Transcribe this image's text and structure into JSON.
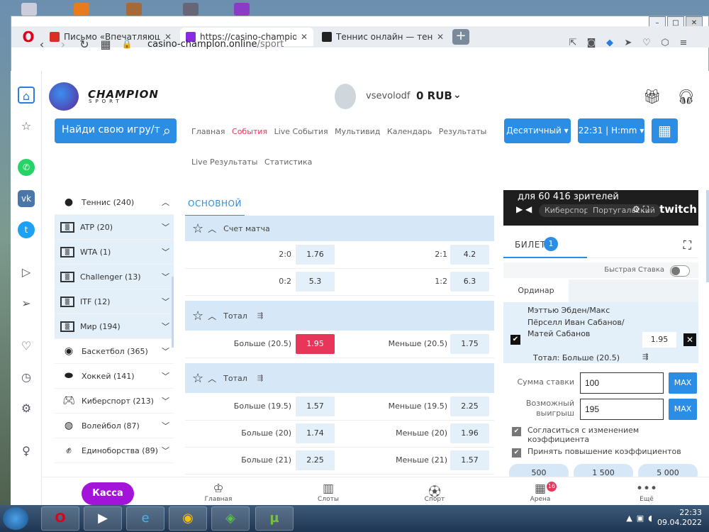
{
  "browser": {
    "tabs": [
      {
        "label": "Письмо «Впечатляющий ж",
        "icon": "gmail-icon",
        "color": "#d93025"
      },
      {
        "label": "https://casino-champion.o",
        "icon": "casino-icon",
        "color": "#8a2be2"
      },
      {
        "label": "Теннис онлайн — теннис",
        "icon": "tennis-site-icon",
        "color": "#222222"
      }
    ],
    "url_host": "casino-champion.online",
    "url_path": "/sport"
  },
  "site": {
    "logo": "CHAMPION",
    "logo_sub": "SPORT",
    "username": "vsevolodf",
    "balance": "0 RUB",
    "search_label": "Найди свою игру/т",
    "nav": [
      "Главная",
      "События",
      "Live События",
      "Мультивид",
      "Календарь",
      "Результаты",
      "Live Результаты",
      "Статистика"
    ],
    "active_nav": "События",
    "odds_format": "Десятичный",
    "time_format": "22:31 | H:mm"
  },
  "sports": [
    {
      "label": "Теннис (240)",
      "sub": false,
      "icon": "tennis-icon"
    },
    {
      "label": "ATP (20)",
      "sub": true,
      "icon": "world-map-icon"
    },
    {
      "label": "WTA (1)",
      "sub": true,
      "icon": "world-map-icon"
    },
    {
      "label": "Challenger (13)",
      "sub": true,
      "icon": "world-map-icon"
    },
    {
      "label": "ITF (12)",
      "sub": true,
      "icon": "world-map-icon"
    },
    {
      "label": "Мир (194)",
      "sub": true,
      "icon": "world-map-icon"
    },
    {
      "label": "Баскетбол (365)",
      "sub": false,
      "icon": "basketball-icon"
    },
    {
      "label": "Хоккей (141)",
      "sub": false,
      "icon": "hockey-icon"
    },
    {
      "label": "Киберспорт (213)",
      "sub": false,
      "icon": "gamepad-icon"
    },
    {
      "label": "Волейбол (87)",
      "sub": false,
      "icon": "volleyball-icon"
    },
    {
      "label": "Единоборства (89)",
      "sub": false,
      "icon": "fight-icon"
    }
  ],
  "center": {
    "tab": "ОСНОВНОЙ",
    "markets": [
      {
        "title": "Счет матча",
        "rows": [
          {
            "l": "2:0",
            "lo": "1.76",
            "r": "2:1",
            "ro": "4.2"
          },
          {
            "l": "0:2",
            "lo": "5.3",
            "r": "1:2",
            "ro": "6.3"
          }
        ]
      },
      {
        "title": "Тотал",
        "rows": [
          {
            "l": "Больше (20.5)",
            "lo": "1.95",
            "r": "Меньше (20.5)",
            "ro": "1.75",
            "selected": true
          }
        ]
      },
      {
        "title": "Тотал",
        "rows": [
          {
            "l": "Больше (19.5)",
            "lo": "1.57",
            "r": "Меньше (19.5)",
            "ro": "2.25"
          },
          {
            "l": "Больше (20)",
            "lo": "1.74",
            "r": "Меньше (20)",
            "ro": "1.96"
          },
          {
            "l": "Больше (21)",
            "lo": "2.25",
            "r": "Меньше (21)",
            "ro": "1.57"
          }
        ]
      }
    ]
  },
  "stream": {
    "title": "для 60 416 зрителей",
    "tag1": "Киберспорт",
    "tag2": "Португальский",
    "brand": "twitch"
  },
  "ticket": {
    "title": "БИЛЕТ",
    "count": "1",
    "fast_bet": "Быстрая Ставка",
    "mode": "Ординар",
    "teams": "Мэттью Эбден/Макс Пёрселл Иван Сабанов/Матей Сабанов",
    "odd": "1.95",
    "total": "Тотал: Больше (20.5)",
    "stake_label": "Сумма ставки",
    "stake": "100",
    "win_label": "Возможный выигрыш",
    "win": "195",
    "max": "MAX",
    "opt1": "Согласиться с изменением коэффициента",
    "opt2": "Принять повышение коэффициентов",
    "quick": [
      "500",
      "1 500",
      "5 000"
    ]
  },
  "bottom": {
    "kassa": "Касса",
    "items": [
      "Главная",
      "Слоты",
      "Спорт",
      "Арена",
      "Ещё"
    ],
    "arena_badge": "16"
  },
  "taskbar": {
    "time": "22:33",
    "date": "09.04.2022"
  }
}
